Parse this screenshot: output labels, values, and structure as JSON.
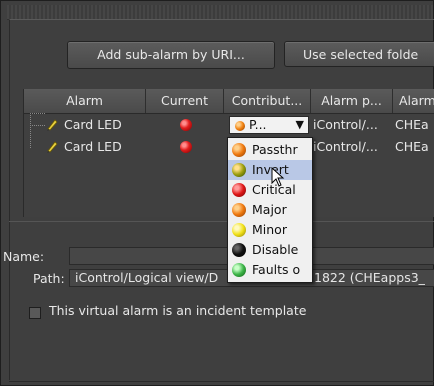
{
  "buttons": {
    "add_sub_alarm": "Add sub-alarm by URI...",
    "use_selected": "Use selected folde"
  },
  "table": {
    "columns": [
      "Alarm",
      "Current",
      "Contribut...",
      "Alarm p...",
      "Alarm"
    ],
    "rows": [
      {
        "name": "Card LED",
        "current": "red",
        "contribution": "P...",
        "path": "iControl/...",
        "alarm": "CHEa"
      },
      {
        "name": "Card LED",
        "current": "red",
        "contribution": "",
        "path": "iControl/...",
        "alarm": "CHEa"
      }
    ]
  },
  "dropdown": {
    "items": [
      {
        "label": "Passthr",
        "icon": "orange-led-icon",
        "color": "#f07a10"
      },
      {
        "label": "Invert",
        "icon": "green-orange-led-icon",
        "color": "#8a8a10",
        "selected": true
      },
      {
        "label": "Critical",
        "icon": "red-led-icon",
        "color": "#e01818"
      },
      {
        "label": "Major",
        "icon": "orange-led-icon",
        "color": "#f07a10"
      },
      {
        "label": "Minor",
        "icon": "yellow-led-icon",
        "color": "#f2e21a"
      },
      {
        "label": "Disable",
        "icon": "black-led-icon",
        "color": "#101010"
      },
      {
        "label": "Faults o",
        "icon": "green-led-icon",
        "color": "#3fb64a"
      }
    ]
  },
  "form": {
    "name_label": "Name:",
    "name_value": "",
    "path_label": "Path:",
    "path_value": "iControl/Logical view/D",
    "path_value_tail": "1822 (CHEapps3_",
    "template_checkbox_label": "This virtual alarm is an incident template"
  }
}
